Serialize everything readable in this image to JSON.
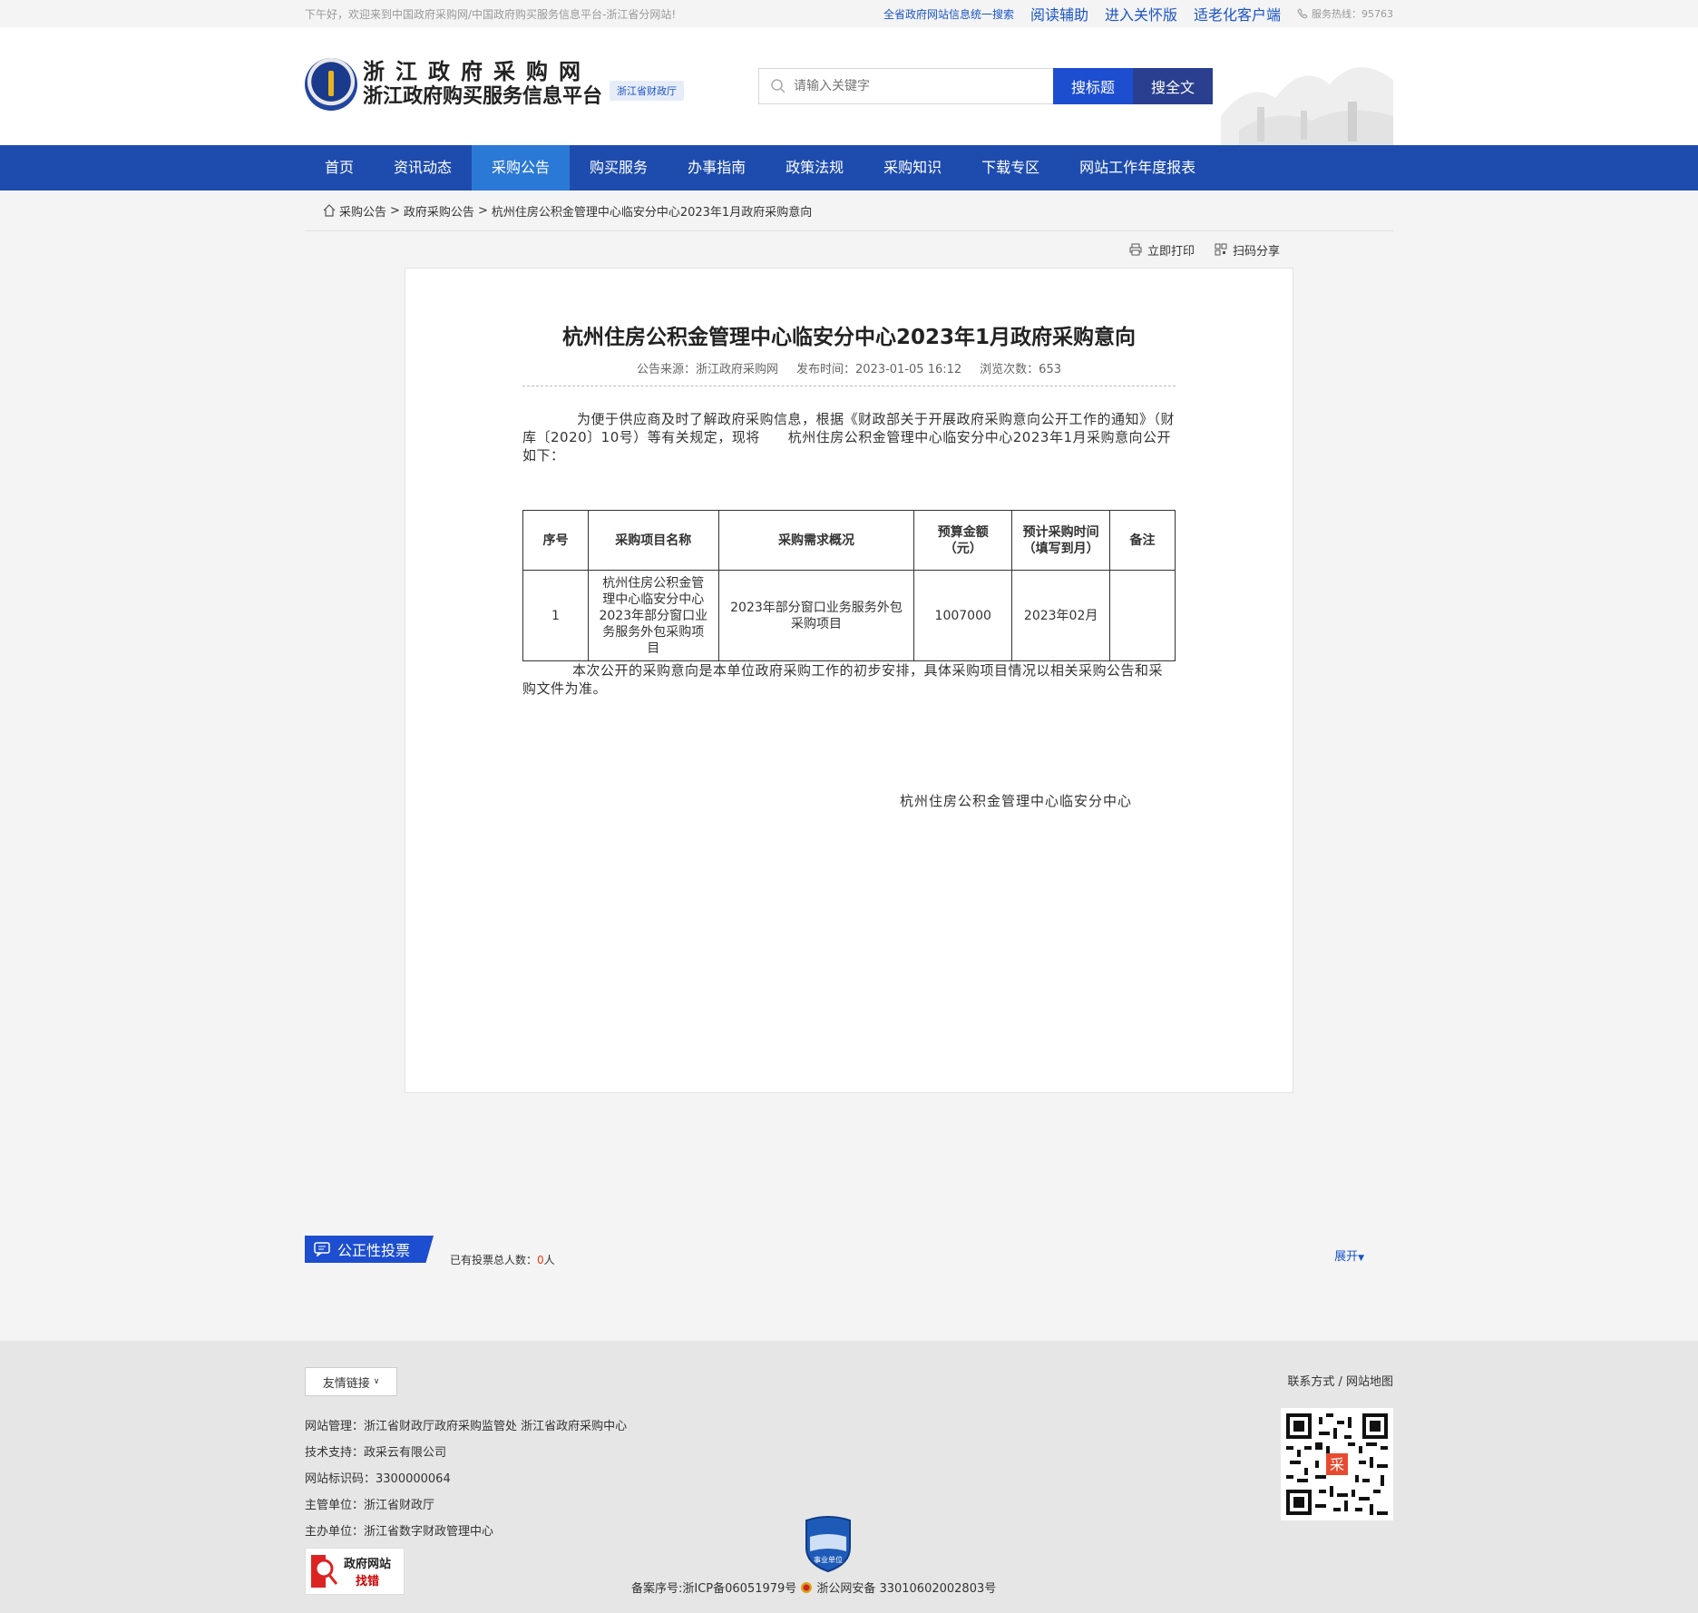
{
  "topbar": {
    "welcome": "下午好，欢迎来到中国政府采购网/中国政府购买服务信息平台-浙江省分网站!",
    "unified_search": "全省政府网站信息统一搜索",
    "read_aid": "阅读辅助",
    "care_version": "进入关怀版",
    "elderly_client": "适老化客户端",
    "hotline": "服务热线：95763"
  },
  "header": {
    "logo_line1": "浙江政府采购网",
    "logo_line2": "浙江政府购买服务信息平台",
    "logo_badge": "浙江省财政厅",
    "search_placeholder": "请输入关键字",
    "search_title_btn": "搜标题",
    "search_full_btn": "搜全文"
  },
  "nav": {
    "items": [
      "首页",
      "资讯动态",
      "采购公告",
      "购买服务",
      "办事指南",
      "政策法规",
      "采购知识",
      "下载专区",
      "网站工作年度报表"
    ],
    "active": "采购公告"
  },
  "breadcrumb": {
    "items": [
      "采购公告",
      "政府采购公告",
      "杭州住房公积金管理中心临安分中心2023年1月政府采购意向"
    ],
    "sep": ">"
  },
  "tools": {
    "print": "立即打印",
    "share": "扫码分享"
  },
  "article": {
    "title": "杭州住房公积金管理中心临安分中心2023年1月政府采购意向",
    "source": "公告来源：浙江政府采购网",
    "publish_time": "发布时间：2023-01-05 16:12",
    "views": "浏览次数：653",
    "intro": "为便于供应商及时了解政府采购信息，根据《财政部关于开展政府采购意向公开工作的通知》（财库〔2020〕10号）等有关规定，现将　　杭州住房公积金管理中心临安分中心2023年1月采购意向公开 如下：",
    "table": {
      "headers": [
        "序号",
        "采购项目名称",
        "采购需求概况",
        "预算金额（元）",
        "预计采购时间（填写到月）",
        "备注"
      ],
      "rows": [
        [
          "1",
          "杭州住房公积金管理中心临安分中心2023年部分窗口业务服务外包采购项目",
          "2023年部分窗口业务服务外包采购项目",
          "1007000",
          "2023年02月",
          ""
        ]
      ]
    },
    "closing": "本次公开的采购意向是本单位政府采购工作的初步安排，具体采购项目情况以相关采购公告和采购文件为准。",
    "signature": "杭州住房公积金管理中心临安分中心"
  },
  "vote": {
    "label": "公正性投票",
    "count_prefix": "已有投票总人数：",
    "count": "0",
    "count_suffix": "人",
    "expand": "展开"
  },
  "footer": {
    "links_btn": "友情链接",
    "contact": "联系方式",
    "sitemap": "网站地图",
    "info": [
      "网站管理：浙江省财政厅政府采购监管处 浙江省政府采购中心",
      "技术支持：政采云有限公司",
      "网站标识码：3300000064",
      "主管单位：浙江省财政厅",
      "主办单位：浙江省数字财政管理中心"
    ],
    "findbug_l1": "政府网站",
    "findbug_l2": "找错",
    "gov_badge": "事业单位",
    "icp": "备案序号:浙ICP备06051979号",
    "police": "浙公网安备 33010602002803号",
    "qr_center": "采"
  },
  "colors": {
    "nav_bg": "#1e4cae",
    "nav_active": "#2b79d6",
    "brand_blue": "#1d4ed0",
    "alert": "#e0411b"
  }
}
